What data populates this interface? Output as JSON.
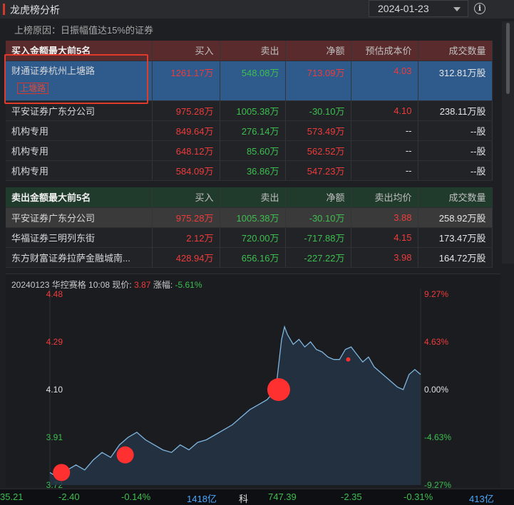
{
  "header": {
    "title": "龙虎榜分析",
    "date": "2024-01-23",
    "info_glyph": "i",
    "reason": "上榜原因：日振幅值达15%的证券"
  },
  "buy_table": {
    "columns": [
      "买入金额最大前5名",
      "买入",
      "卖出",
      "净额",
      "预估成本价",
      "成交数量"
    ],
    "rows": [
      {
        "name": "财通证券杭州上塘路",
        "badge": "上塘路",
        "buy": "1261.17万",
        "sell": "548.08万",
        "net": "713.09万",
        "cost": "4.03",
        "volume": "312.81万股"
      },
      {
        "name": "平安证券广东分公司",
        "buy": "975.28万",
        "sell": "1005.38万",
        "net": "-30.10万",
        "cost": "4.10",
        "volume": "238.11万股"
      },
      {
        "name": "机构专用",
        "buy": "849.64万",
        "sell": "276.14万",
        "net": "573.49万",
        "cost": "--",
        "volume": "--股"
      },
      {
        "name": "机构专用",
        "buy": "648.12万",
        "sell": "85.60万",
        "net": "562.52万",
        "cost": "--",
        "volume": "--股"
      },
      {
        "name": "机构专用",
        "buy": "584.09万",
        "sell": "36.86万",
        "net": "547.23万",
        "cost": "--",
        "volume": "--股"
      }
    ]
  },
  "sell_table": {
    "columns": [
      "卖出金额最大前5名",
      "买入",
      "卖出",
      "净额",
      "卖出均价",
      "成交数量"
    ],
    "rows": [
      {
        "name": "平安证券广东分公司",
        "buy": "975.28万",
        "sell": "1005.38万",
        "net": "-30.10万",
        "cost": "3.88",
        "volume": "258.92万股"
      },
      {
        "name": "华福证券三明列东街",
        "buy": "2.12万",
        "sell": "720.00万",
        "net": "-717.88万",
        "cost": "4.15",
        "volume": "173.47万股"
      },
      {
        "name": "东方财富证券拉萨金融城南...",
        "buy": "428.94万",
        "sell": "656.16万",
        "net": "-227.22万",
        "cost": "3.98",
        "volume": "164.72万股"
      }
    ]
  },
  "chart_info": {
    "prefix": "20240123 华控赛格 10:08 现价:",
    "price": "3.87",
    "chg_label": "涨幅:",
    "chg": "-5.61%"
  },
  "chart_data": {
    "type": "line",
    "title": "",
    "y_left_ticks": [
      "4.48",
      "4.29",
      "4.10",
      "3.91",
      "3.72"
    ],
    "y_right_ticks": [
      "9.27%",
      "4.63%",
      "0.00%",
      "-4.63%",
      "-9.27%"
    ],
    "ylim": [
      3.72,
      4.48
    ],
    "prev_close": 4.1,
    "points": [
      [
        0,
        3.77
      ],
      [
        6,
        3.75
      ],
      [
        12,
        3.78
      ],
      [
        18,
        3.8
      ],
      [
        24,
        3.78
      ],
      [
        30,
        3.82
      ],
      [
        36,
        3.85
      ],
      [
        42,
        3.83
      ],
      [
        48,
        3.88
      ],
      [
        54,
        3.91
      ],
      [
        60,
        3.93
      ],
      [
        66,
        3.9
      ],
      [
        72,
        3.88
      ],
      [
        78,
        3.86
      ],
      [
        84,
        3.85
      ],
      [
        90,
        3.88
      ],
      [
        96,
        3.86
      ],
      [
        102,
        3.89
      ],
      [
        108,
        3.9
      ],
      [
        114,
        3.92
      ],
      [
        120,
        3.94
      ],
      [
        126,
        3.96
      ],
      [
        132,
        3.99
      ],
      [
        138,
        4.02
      ],
      [
        144,
        4.04
      ],
      [
        150,
        4.06
      ],
      [
        156,
        4.1
      ],
      [
        160,
        4.3
      ],
      [
        162,
        4.35
      ],
      [
        164,
        4.32
      ],
      [
        168,
        4.28
      ],
      [
        172,
        4.3
      ],
      [
        176,
        4.27
      ],
      [
        180,
        4.29
      ],
      [
        184,
        4.26
      ],
      [
        188,
        4.25
      ],
      [
        192,
        4.23
      ],
      [
        196,
        4.22
      ],
      [
        200,
        4.22
      ],
      [
        204,
        4.26
      ],
      [
        208,
        4.27
      ],
      [
        212,
        4.24
      ],
      [
        216,
        4.21
      ],
      [
        220,
        4.23
      ],
      [
        224,
        4.19
      ],
      [
        228,
        4.17
      ],
      [
        232,
        4.15
      ],
      [
        236,
        4.13
      ],
      [
        240,
        4.11
      ],
      [
        244,
        4.1
      ],
      [
        248,
        4.16
      ],
      [
        252,
        4.18
      ],
      [
        256,
        4.16
      ]
    ],
    "markers": [
      {
        "x": 8,
        "y": 3.77,
        "size": "medium"
      },
      {
        "x": 52,
        "y": 3.84,
        "size": "medium"
      },
      {
        "x": 158,
        "y": 4.1,
        "size": "large"
      },
      {
        "x": 206,
        "y": 4.22,
        "size": "small"
      }
    ],
    "colors": {
      "line": "#7fb6e0",
      "fill": "#243445",
      "marker": "#ff3030"
    }
  },
  "ticker": {
    "items": [
      "35.21",
      "-2.40",
      "-0.14%",
      "1418亿",
      "科",
      "747.39",
      "-2.35",
      "-0.31%",
      "413亿"
    ]
  }
}
